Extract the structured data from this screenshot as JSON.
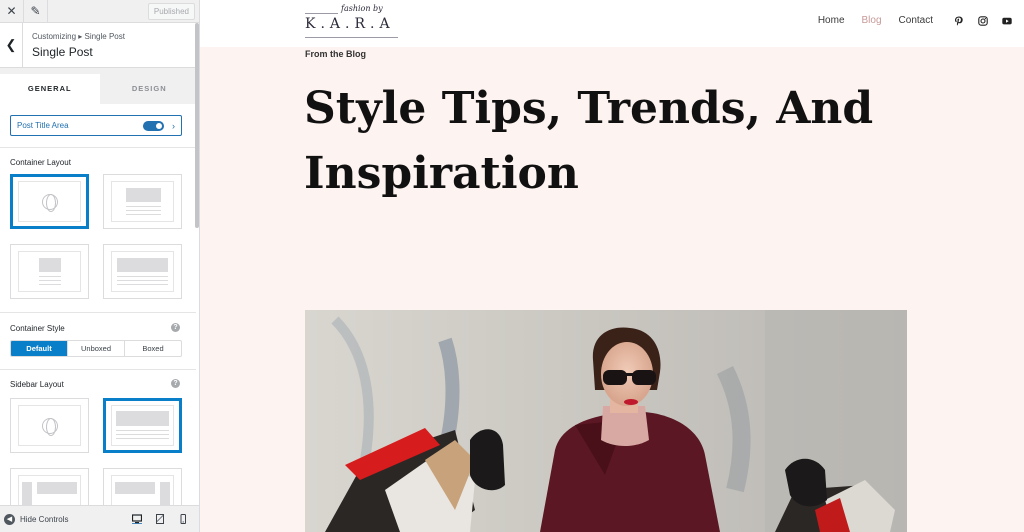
{
  "customizer": {
    "close_icon": "close-icon",
    "edit_icon": "pencil-icon",
    "published_label": "Published",
    "breadcrumb": "Customizing ▸ Single Post",
    "section_title": "Single Post",
    "tabs": [
      {
        "label": "GENERAL",
        "active": true
      },
      {
        "label": "DESIGN",
        "active": false
      }
    ],
    "post_title_area": {
      "label": "Post Title Area",
      "enabled": true
    },
    "container_layout": {
      "label": "Container Layout",
      "selected_index": 0
    },
    "container_style": {
      "label": "Container Style",
      "options": [
        "Default",
        "Unboxed",
        "Boxed"
      ],
      "selected": "Default"
    },
    "sidebar_layout": {
      "label": "Sidebar Layout",
      "selected_index": 1
    },
    "footer": {
      "hide_controls_label": "Hide Controls"
    },
    "accent_color": "#0a7fc9"
  },
  "site": {
    "logo": {
      "script": "fashion by",
      "name": "K.A.R.A"
    },
    "nav": [
      "Home",
      "Blog",
      "Contact"
    ],
    "active_nav": "Blog",
    "social_icons": [
      "pinterest-icon",
      "instagram-icon",
      "youtube-icon"
    ],
    "kicker": "From the Blog",
    "post_title": "Style Tips, Trends, And Inspiration",
    "background_color": "#fdf3f1"
  }
}
